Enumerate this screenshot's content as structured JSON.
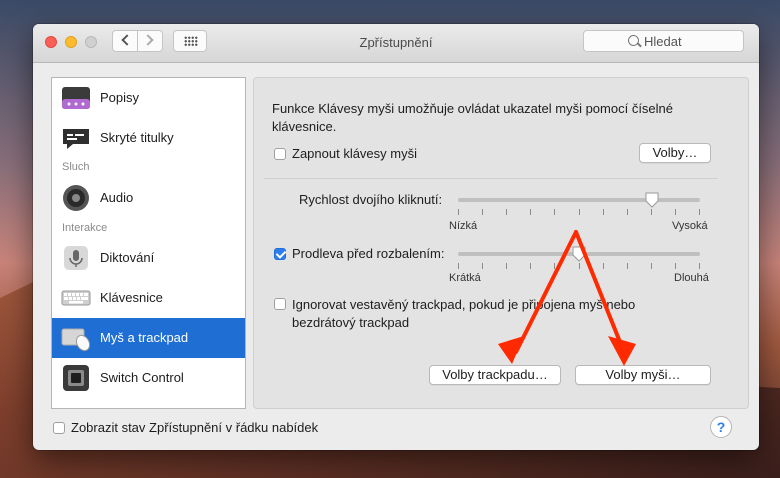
{
  "window": {
    "title": "Zpřístupnění"
  },
  "search": {
    "placeholder": "Hledat"
  },
  "sidebar": {
    "items": [
      {
        "label": "Popisy",
        "icon": "captions-icon"
      },
      {
        "label": "Skryté titulky",
        "icon": "subtitles-icon"
      },
      {
        "label": "Audio",
        "icon": "speaker-icon"
      },
      {
        "label": "Diktování",
        "icon": "microphone-icon"
      },
      {
        "label": "Klávesnice",
        "icon": "keyboard-icon"
      },
      {
        "label": "Myš a trackpad",
        "icon": "mouse-trackpad-icon",
        "selected": true
      },
      {
        "label": "Switch Control",
        "icon": "switch-control-icon"
      }
    ],
    "headers": [
      "Sluch",
      "Interakce"
    ]
  },
  "panel": {
    "description": "Funkce Klávesy myši umožňuje ovládat ukazatel myši pomocí číselné klávesnice.",
    "mouse_keys_label": "Zapnout klávesy myši",
    "mouse_keys_checked": false,
    "options_button": "Volby…",
    "double_click_label": "Rychlost dvojího kliknutí:",
    "double_click_min": "Nízká",
    "double_click_max": "Vysoká",
    "double_click_value": 0.8,
    "spring_delay_label": "Prodleva před rozbalením:",
    "spring_delay_checked": true,
    "spring_delay_min": "Krátká",
    "spring_delay_max": "Dlouhá",
    "spring_delay_value": 0.5,
    "ignore_trackpad_label": "Ignorovat vestavěný trackpad, pokud je připojena myš nebo bezdrátový trackpad",
    "ignore_trackpad_checked": false,
    "trackpad_options_button": "Volby trackpadu…",
    "mouse_options_button": "Volby myši…"
  },
  "footer": {
    "show_status_label": "Zobrazit stav Zpřístupnění v řádku nabídek",
    "show_status_checked": false,
    "help": "?"
  },
  "colors": {
    "accent": "#1f6ed4",
    "annotation": "#ff2a00"
  }
}
